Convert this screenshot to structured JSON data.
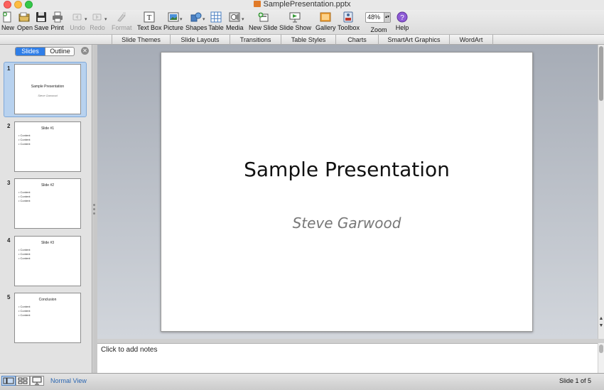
{
  "window": {
    "title": "SamplePresentation.pptx"
  },
  "toolbar": {
    "new": "New",
    "open": "Open",
    "save": "Save",
    "print": "Print",
    "undo": "Undo",
    "redo": "Redo",
    "format": "Format",
    "text_box": "Text Box",
    "picture": "Picture",
    "shapes": "Shapes",
    "table": "Table",
    "media": "Media",
    "new_slide": "New Slide",
    "slide_show": "Slide Show",
    "gallery": "Gallery",
    "toolbox": "Toolbox",
    "zoom": "Zoom",
    "zoom_value": "48%",
    "help": "Help"
  },
  "ribbon": {
    "tabs": [
      "Slide Themes",
      "Slide Layouts",
      "Transitions",
      "Table Styles",
      "Charts",
      "SmartArt Graphics",
      "WordArt"
    ]
  },
  "left_panel": {
    "tab_slides": "Slides",
    "tab_outline": "Outline",
    "slides": [
      {
        "num": "1",
        "title": "Sample Presentation",
        "subtitle": "Steve Garwood",
        "bullets": []
      },
      {
        "num": "2",
        "title": "Slide #1",
        "subtitle": "",
        "bullets": [
          "Content",
          "Content",
          "Content"
        ]
      },
      {
        "num": "3",
        "title": "Slide #2",
        "subtitle": "",
        "bullets": [
          "Content",
          "Content",
          "Content"
        ]
      },
      {
        "num": "4",
        "title": "Slide #3",
        "subtitle": "",
        "bullets": [
          "Content",
          "Content",
          "Content"
        ]
      },
      {
        "num": "5",
        "title": "Conclusion",
        "subtitle": "",
        "bullets": [
          "Content",
          "Content",
          "Content"
        ]
      }
    ]
  },
  "slide": {
    "title": "Sample Presentation",
    "subtitle": "Steve Garwood"
  },
  "notes": {
    "placeholder": "Click to add notes"
  },
  "status": {
    "view": "Normal View",
    "slide_count": "Slide 1 of 5"
  },
  "colors": {
    "accent": "#2f7ee8",
    "selection": "#b8d2ef"
  }
}
